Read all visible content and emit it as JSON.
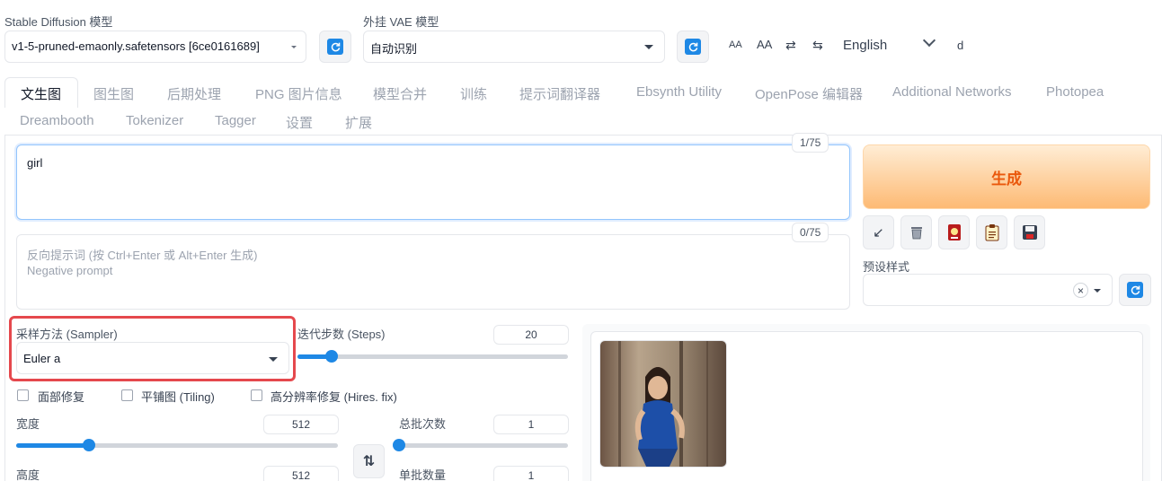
{
  "header": {
    "sd_model_label": "Stable Diffusion 模型",
    "sd_model_value": "v1-5-pruned-emaonly.safetensors [6ce0161689]",
    "vae_label": "外挂 VAE 模型",
    "vae_value": "自动识别",
    "font_small_label": "AA",
    "font_large_label": "AA",
    "swap_icon_glyph": "⇄",
    "tab_icon_glyph": "⇆",
    "language": "English",
    "extra_letter": "d"
  },
  "tabs": {
    "row1": [
      "文生图",
      "图生图",
      "后期处理",
      "PNG 图片信息",
      "模型合并",
      "训练",
      "提示词翻译器",
      "Ebsynth Utility",
      "OpenPose 编辑器",
      "Additional Networks",
      "Photopea"
    ],
    "row2": [
      "Dreambooth",
      "Tokenizer",
      "Tagger",
      "设置",
      "扩展"
    ],
    "active": "文生图"
  },
  "prompt": {
    "value": "girl",
    "counter": "1/75"
  },
  "negative_prompt": {
    "placeholder_line1": "反向提示词 (按 Ctrl+Enter 或 Alt+Enter 生成)",
    "placeholder_line2": "Negative prompt",
    "counter": "0/75"
  },
  "generate_label": "生成",
  "styles": {
    "label": "预设样式",
    "clear_glyph": "×"
  },
  "sampler": {
    "label": "采样方法 (Sampler)",
    "value": "Euler a"
  },
  "steps": {
    "label": "迭代步数 (Steps)",
    "value": 20,
    "min": 1,
    "max": 150
  },
  "checkboxes": {
    "face_restore": "面部修复",
    "tiling": "平铺图 (Tiling)",
    "hires_fix": "高分辨率修复 (Hires. fix)"
  },
  "width": {
    "label": "宽度",
    "value": 512,
    "min": 64,
    "max": 2048
  },
  "height": {
    "label": "高度",
    "value": 512
  },
  "batch_count": {
    "label": "总批次数",
    "value": 1,
    "min": 1,
    "max": 100
  },
  "batch_size": {
    "label": "单批数量",
    "value": 1
  },
  "swap_dims_glyph": "⇅",
  "colors": {
    "accent": "#1e88e5",
    "generate_text": "#ea580c",
    "highlight_border": "#e5484d"
  }
}
